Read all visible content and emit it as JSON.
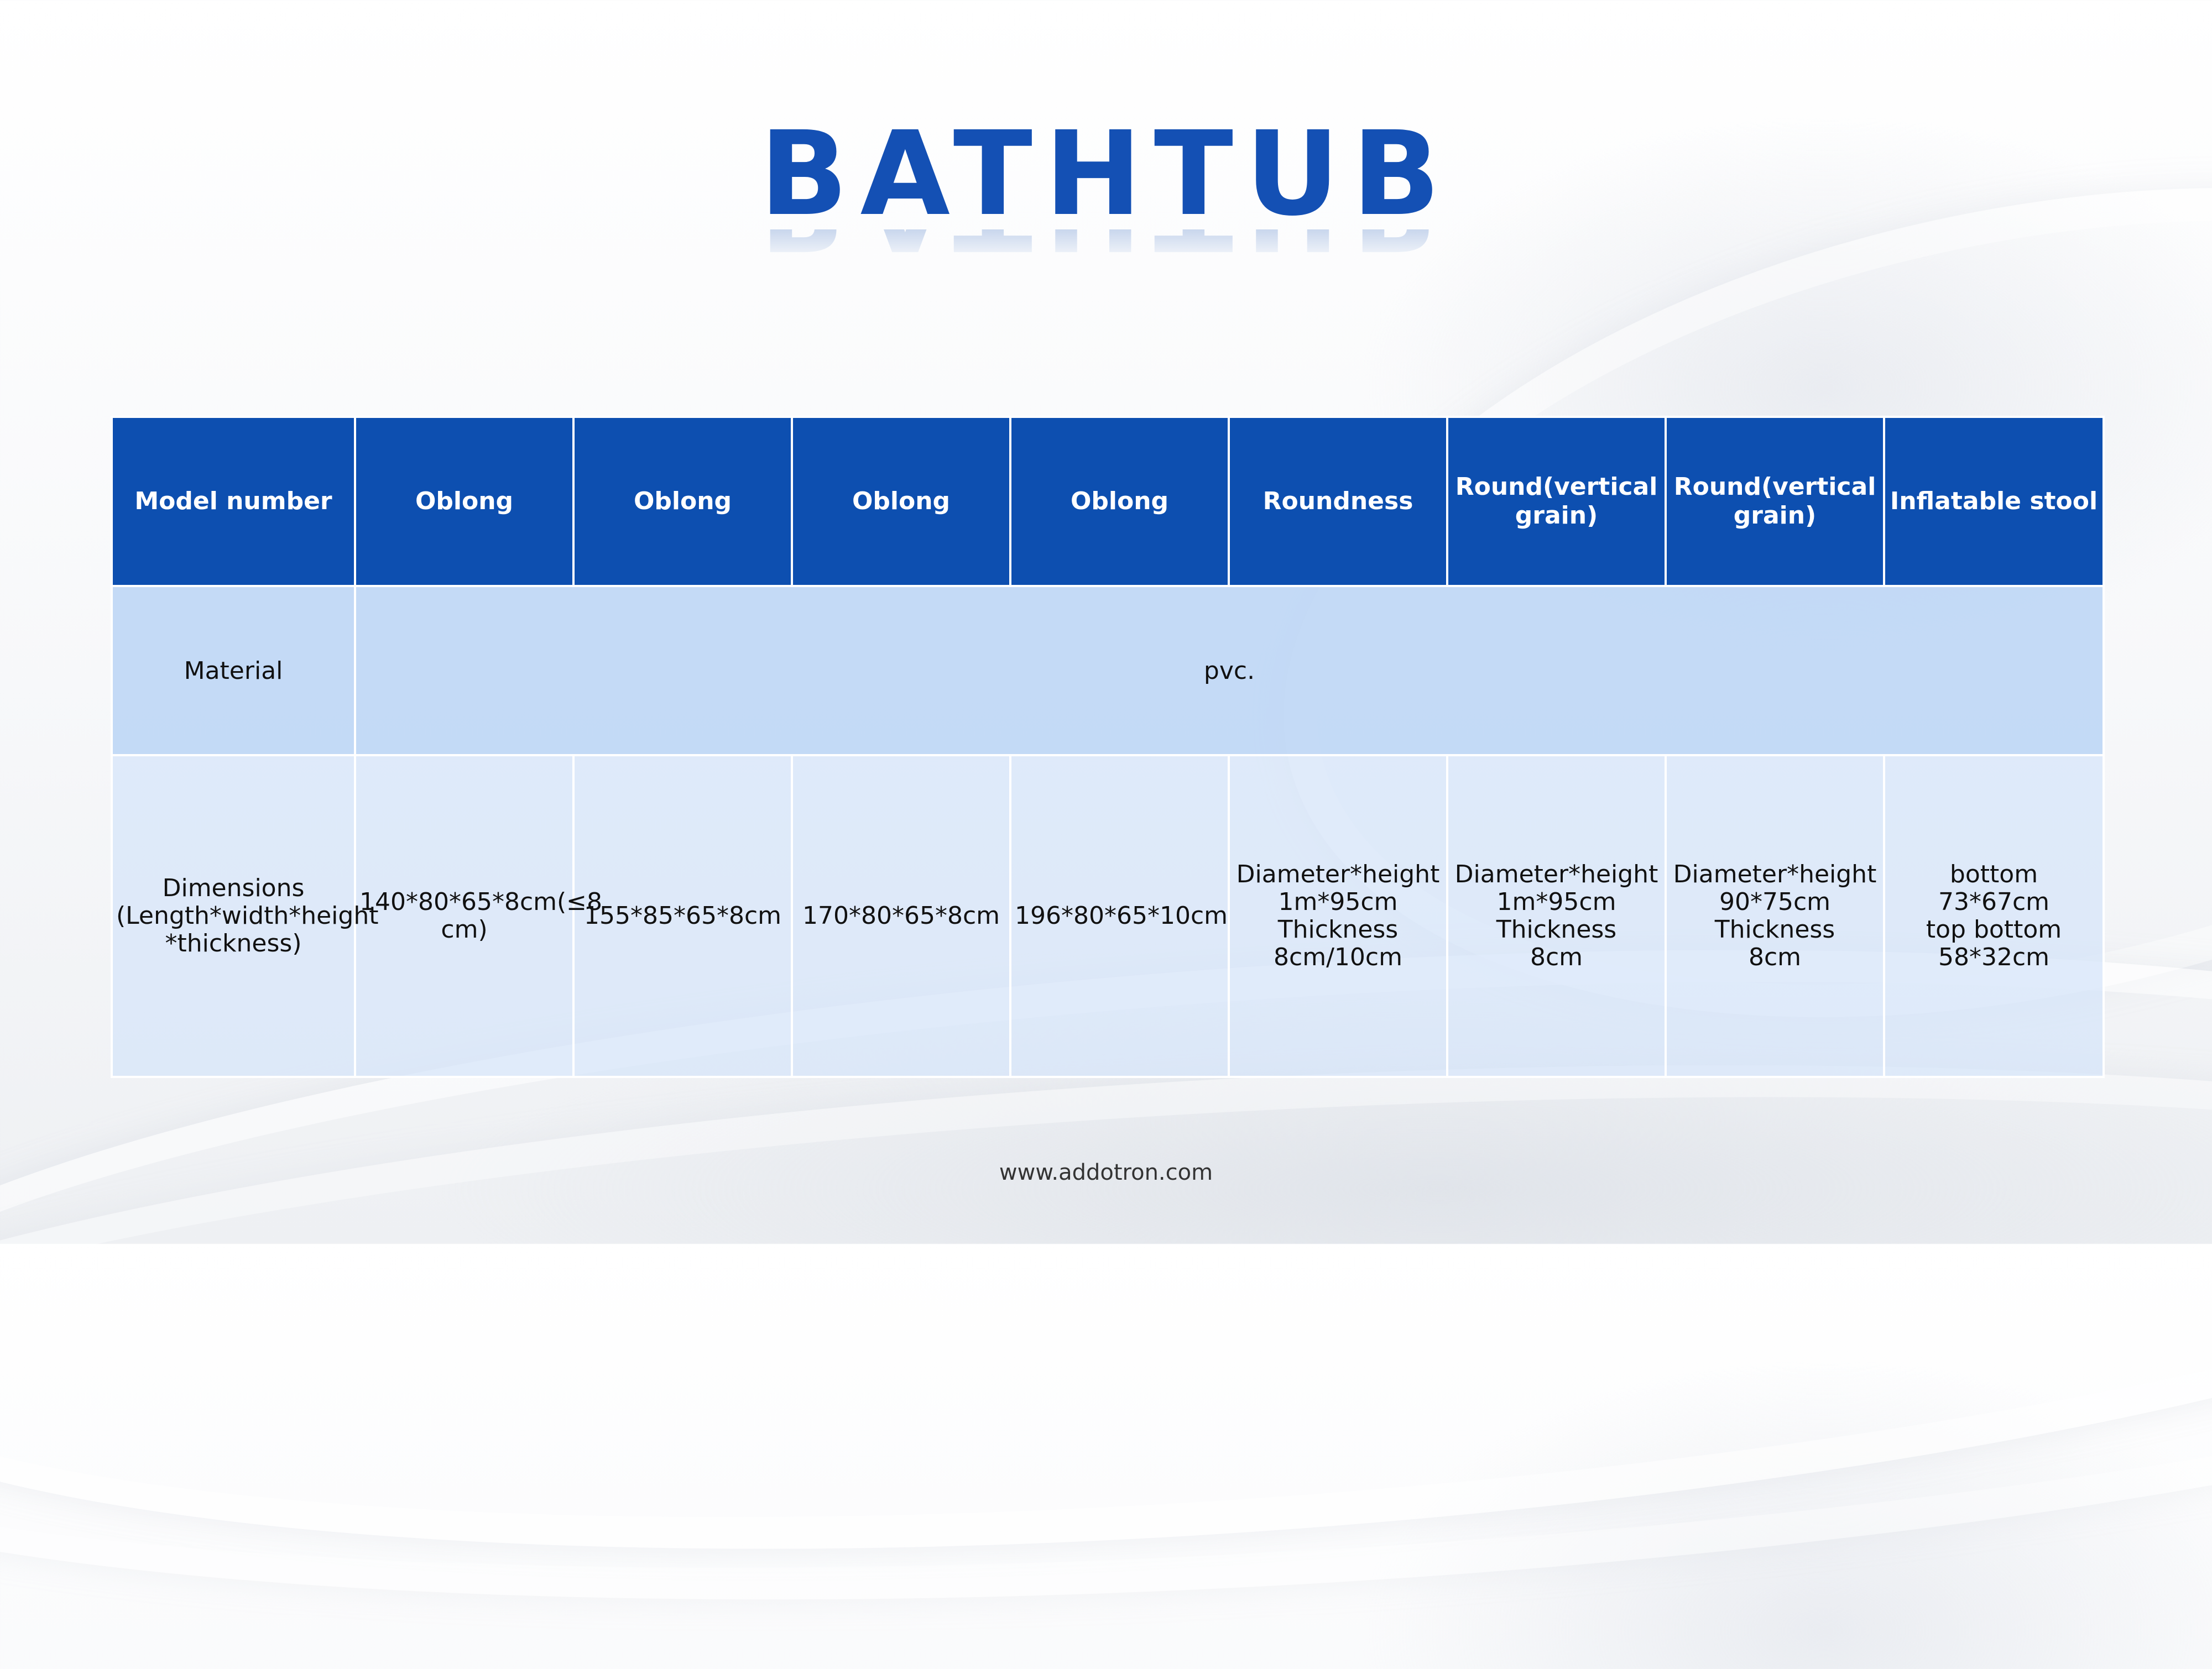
{
  "title": "BATHTUB",
  "table": {
    "header": {
      "label": "Model number",
      "columns": [
        "Oblong",
        "Oblong",
        "Oblong",
        "Oblong",
        "Roundness",
        "Round(vertical grain)",
        "Round(vertical grain)",
        "Inflatable stool"
      ]
    },
    "material": {
      "label": "Material",
      "value": "pvc."
    },
    "dimensions": {
      "label": "Dimensions\n(Length*width*height\n*thickness)",
      "values": [
        "140*80*65*8cm(≤8\ncm)",
        "155*85*65*8cm",
        "170*80*65*8cm",
        "196*80*65*10cm",
        "Diameter*height\n1m*95cm\nThickness\n8cm/10cm",
        "Diameter*height\n1m*95cm\nThickness\n8cm",
        "Diameter*height\n90*75cm\nThickness\n8cm",
        "bottom\n73*67cm\ntop bottom\n58*32cm"
      ]
    }
  },
  "footer": "www.addotron.com",
  "colors": {
    "title": "#1450b4",
    "header_bg": "#0d4fb0",
    "material_bg": "#bed6f5",
    "dimensions_bg": "#d6e5f9"
  }
}
